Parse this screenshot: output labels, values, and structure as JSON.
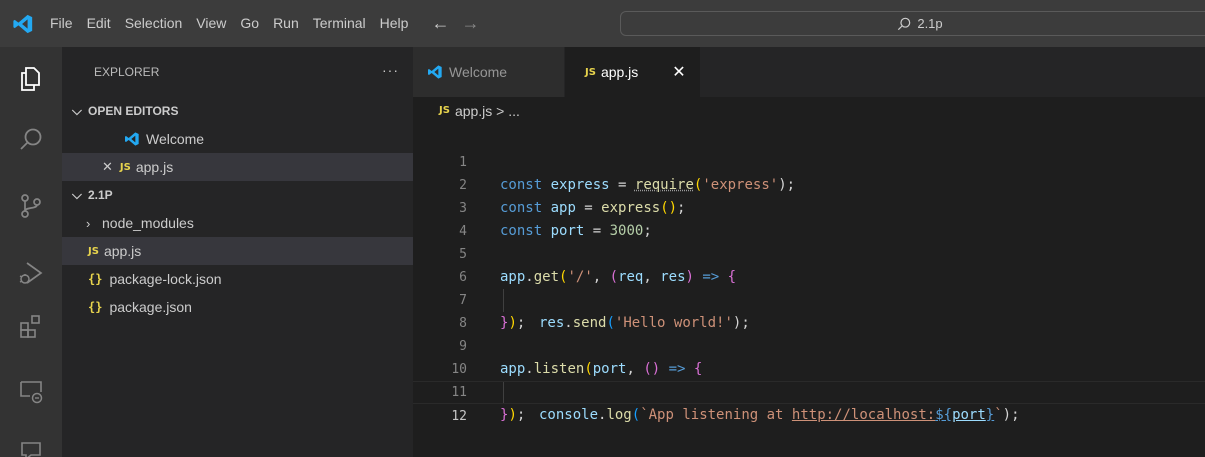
{
  "titlebar": {
    "menu": [
      "File",
      "Edit",
      "Selection",
      "View",
      "Go",
      "Run",
      "Terminal",
      "Help"
    ],
    "back_arrow": "←",
    "forward_arrow": "→",
    "search_text": "2.1p"
  },
  "sidebar": {
    "header": "EXPLORER",
    "more": "···",
    "open_editors_title": "OPEN EDITORS",
    "open_editors": [
      "Welcome",
      "app.js"
    ],
    "folder_title": "2.1P",
    "tree": [
      "node_modules",
      "app.js",
      "package-lock.json",
      "package.json"
    ],
    "js_badge": "JS",
    "json_badge": "{}"
  },
  "editor": {
    "tabs": [
      "Welcome",
      "app.js"
    ],
    "breadcrumb": "app.js > ...",
    "line_numbers": [
      "1",
      "2",
      "3",
      "4",
      "5",
      "6",
      "7",
      "8",
      "9",
      "10",
      "11",
      "12"
    ],
    "code": {
      "l1": [
        "const",
        " express",
        " = ",
        "require",
        "(",
        "'express'",
        ");"
      ],
      "l2": [
        "const",
        " app",
        " = ",
        "express",
        "()",
        ";"
      ],
      "l3": [
        "const",
        " port",
        " = ",
        "3000",
        ";"
      ],
      "l5": [
        "app",
        ".",
        "get",
        "(",
        "'/'",
        ", ",
        "(",
        "req",
        ", ",
        "res",
        ")",
        " => ",
        "{"
      ],
      "l6": [
        "res",
        ".",
        "send",
        "(",
        "'Hello world!'",
        ");"
      ],
      "l7": [
        "}",
        ")",
        ";"
      ],
      "l9": [
        "app",
        ".",
        "listen",
        "(",
        "port",
        ", ",
        "()",
        " => ",
        "{"
      ],
      "l10": [
        "console",
        ".",
        "log",
        "(",
        "`App listening at ",
        "http://localhost:",
        "${",
        "port",
        "}",
        "`",
        ");"
      ],
      "l11": [
        "}",
        ")",
        ";"
      ]
    }
  },
  "colors": {
    "accent": "#007acc",
    "js_yellow": "#e8d44d",
    "keyword": "#569cd6",
    "string": "#ce9178"
  }
}
